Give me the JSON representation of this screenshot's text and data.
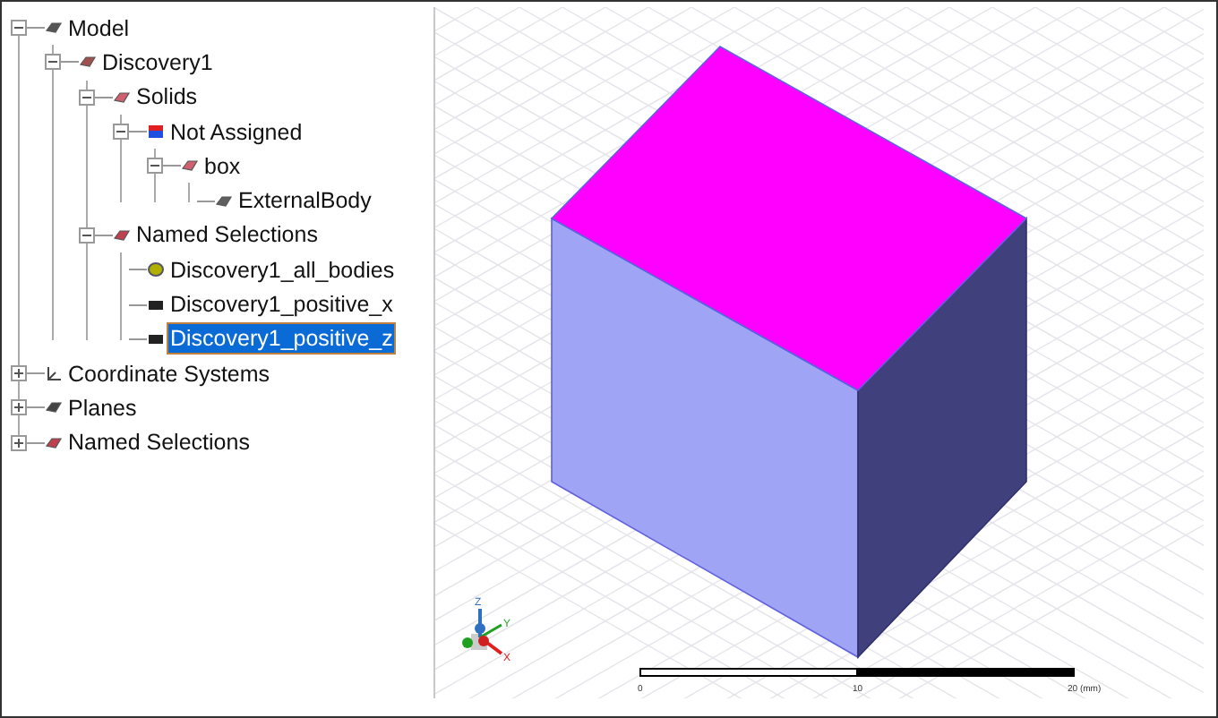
{
  "tree": [
    {
      "label": "Model",
      "kind": "model",
      "expanded": true,
      "selected": false,
      "children": [
        {
          "label": "Discovery1",
          "kind": "part",
          "expanded": true,
          "selected": false,
          "children": [
            {
              "label": "Solids",
              "kind": "bodies",
              "expanded": true,
              "selected": false,
              "children": [
                {
                  "label": "Not Assigned",
                  "kind": "material",
                  "expanded": true,
                  "selected": false,
                  "children": [
                    {
                      "label": "box",
                      "kind": "bodies",
                      "expanded": true,
                      "selected": false,
                      "children": [
                        {
                          "label": "ExternalBody",
                          "kind": "body",
                          "selected": false
                        }
                      ]
                    }
                  ]
                }
              ]
            },
            {
              "label": "Named Selections",
              "kind": "selections",
              "expanded": true,
              "selected": false,
              "children": [
                {
                  "label": "Discovery1_all_bodies",
                  "kind": "all",
                  "selected": false
                },
                {
                  "label": "Discovery1_positive_x",
                  "kind": "face",
                  "selected": false
                },
                {
                  "label": "Discovery1_positive_z",
                  "kind": "face",
                  "selected": true
                }
              ]
            }
          ]
        }
      ]
    },
    {
      "label": "Coordinate Systems",
      "kind": "axes",
      "expanded": false,
      "selected": false
    },
    {
      "label": "Planes",
      "kind": "plane",
      "expanded": false,
      "selected": false
    },
    {
      "label": "Named Selections",
      "kind": "selections",
      "expanded": false,
      "selected": false
    }
  ],
  "viewport": {
    "triad": {
      "z": "Z",
      "y": "Y",
      "x": "X"
    },
    "scale": {
      "start": "0",
      "mid": "10",
      "end": "20 (mm)"
    }
  }
}
